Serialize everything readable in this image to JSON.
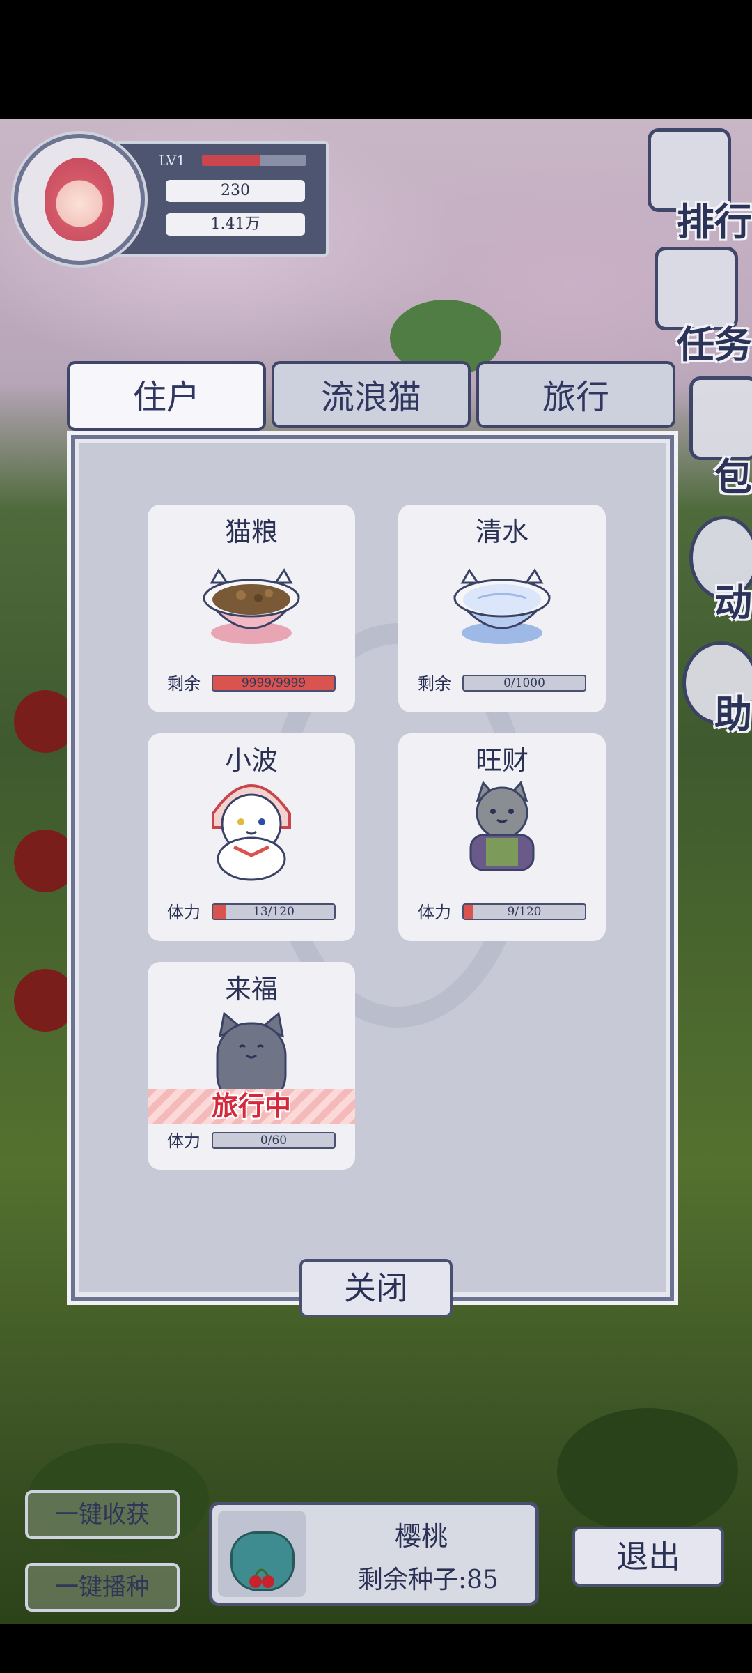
{
  "profile": {
    "level_label": "LV1",
    "exp_fraction": 0.55,
    "hearts": "230",
    "coins": "1.41万"
  },
  "side_menu": [
    {
      "label": "排行",
      "icon": "ranking-icon"
    },
    {
      "label": "任务",
      "icon": "task-scroll-icon"
    },
    {
      "label": "包",
      "icon": "bag-icon"
    },
    {
      "label": "动",
      "icon": "activity-icon"
    },
    {
      "label": "助",
      "icon": "help-icon"
    }
  ],
  "tabs": [
    {
      "label": "住户",
      "active": true
    },
    {
      "label": "流浪猫",
      "active": false
    },
    {
      "label": "旅行",
      "active": false
    }
  ],
  "cards": [
    {
      "title": "猫粮",
      "meter_label": "剩余",
      "meter_text": "9999/9999",
      "meter_fraction": 1.0,
      "fill_color": "#d9534f",
      "art": "cat-food-bowl"
    },
    {
      "title": "清水",
      "meter_label": "剩余",
      "meter_text": "0/1000",
      "meter_fraction": 0.0,
      "fill_color": "#5b7fd1",
      "art": "water-bowl"
    },
    {
      "title": "小波",
      "meter_label": "体力",
      "meter_text": "13/120",
      "meter_fraction": 0.108,
      "fill_color": "#d9534f",
      "art": "white-cat"
    },
    {
      "title": "旺财",
      "meter_label": "体力",
      "meter_text": "9/120",
      "meter_fraction": 0.075,
      "fill_color": "#d9534f",
      "art": "gray-tabby-cat"
    },
    {
      "title": "来福",
      "meter_label": "体力",
      "meter_text": "0/60",
      "meter_fraction": 0.0,
      "fill_color": "#d9534f",
      "art": "gray-cat",
      "banner": "旅行中"
    }
  ],
  "close_label": "关闭",
  "bottom": {
    "harvest_label": "一键收获",
    "sow_label": "一键播种",
    "seed_name": "樱桃",
    "seed_count_text": "剩余种子:85",
    "exit_label": "退出"
  }
}
